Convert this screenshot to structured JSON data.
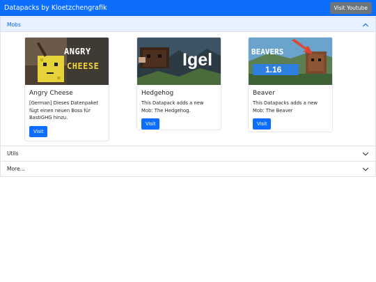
{
  "navbar": {
    "brand": "Datapacks by Kloetzchengrafik",
    "youtube_button": "Visit Youtube"
  },
  "accordion": {
    "sections": [
      {
        "label": "Mobs",
        "expanded": true
      },
      {
        "label": "Utils",
        "expanded": false
      },
      {
        "label": "More...",
        "expanded": false
      }
    ]
  },
  "cards": [
    {
      "title": "Angry Cheese",
      "text": "[German] Dieses Datenpaket fügt einen neuen Boss für BastiGHG hinzu.",
      "button": "Visit",
      "image_text_1": "ANGRY",
      "image_text_2": "CHEESE"
    },
    {
      "title": "Hedgehog",
      "text": "This Datapack adds a new Mob: The Hedgehog.",
      "button": "Visit",
      "image_text_1": "Igel"
    },
    {
      "title": "Beaver",
      "text": "This Datapacks adds a new Mob: The Beaver",
      "button": "Visit",
      "image_text_1": "BEAVERS",
      "image_text_2": "1.16"
    }
  ],
  "colors": {
    "primary": "#0d6efd",
    "secondary": "#6c757d",
    "accordion_active_bg": "#e7f1ff",
    "accordion_active_text": "#0c63e4"
  }
}
